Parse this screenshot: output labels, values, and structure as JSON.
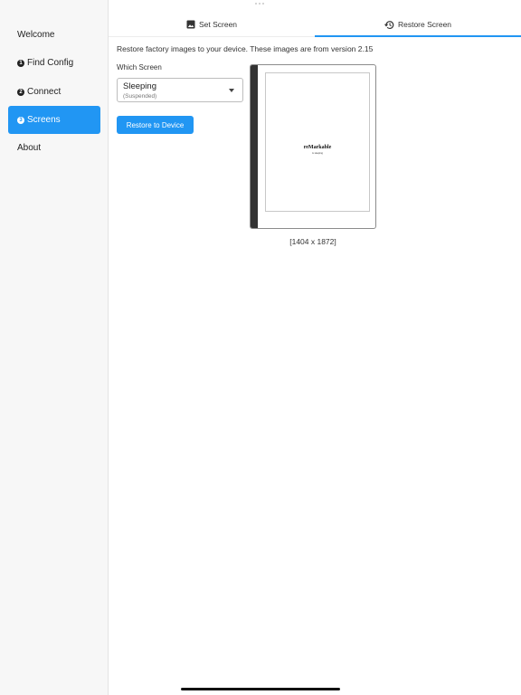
{
  "sidebar": {
    "items": [
      {
        "label": "Welcome",
        "step": ""
      },
      {
        "label": "Find Config",
        "step": "1"
      },
      {
        "label": "Connect",
        "step": "2"
      },
      {
        "label": "Screens",
        "step": "3"
      },
      {
        "label": "About",
        "step": ""
      }
    ],
    "active_index": 3
  },
  "tabs": [
    {
      "label": "Set Screen",
      "icon": "image-icon"
    },
    {
      "label": "Restore Screen",
      "icon": "history-icon"
    }
  ],
  "active_tab": 1,
  "main": {
    "intro": "Restore factory images to your device. These images are from version 2.15",
    "which_screen_label": "Which Screen",
    "select": {
      "value": "Sleeping",
      "sub": "(Suspended)"
    },
    "restore_button": "Restore to Device",
    "preview": {
      "logo": "reMarkable",
      "subtitle": "is sleeping",
      "dimensions": "[1404 x 1872]"
    }
  },
  "colors": {
    "accent": "#2196f3",
    "sidebar_bg": "#f7f7f7"
  }
}
